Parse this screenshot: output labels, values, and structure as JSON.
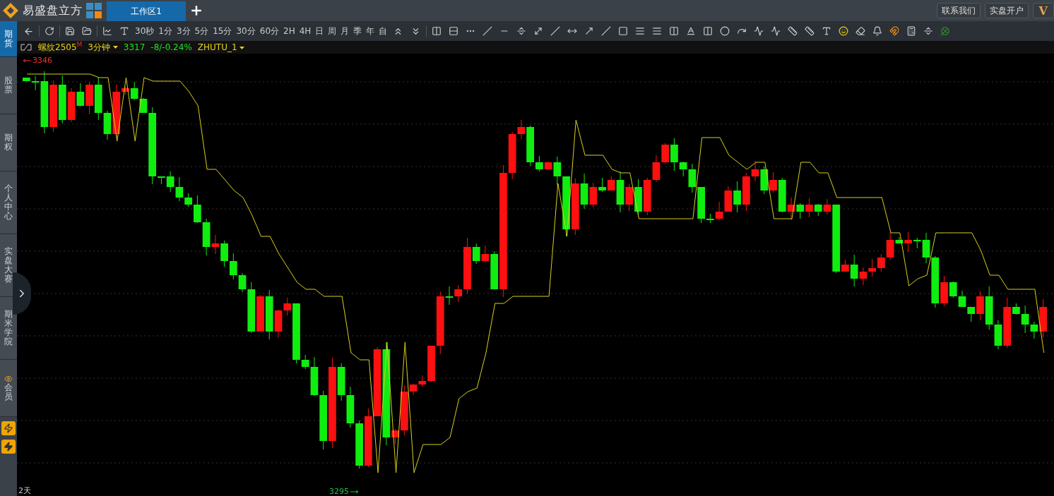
{
  "header": {
    "logo_text": "易盛盘立方",
    "tabs": [
      {
        "label": "工作区1",
        "selected": true
      }
    ],
    "right_buttons": [
      "联系我们",
      "实盘开户",
      "V"
    ]
  },
  "toolbar": {
    "periods": [
      "30秒",
      "1分",
      "3分",
      "5分",
      "15分",
      "30分",
      "60分",
      "2H",
      "4H",
      "日",
      "周",
      "月",
      "季",
      "年",
      "自"
    ]
  },
  "sidebar": {
    "items": [
      {
        "label": "期货",
        "selected": true
      },
      {
        "label": "股票",
        "selected": false
      },
      {
        "label": "期权",
        "selected": false
      },
      {
        "label": "个人中心",
        "selected": false
      },
      {
        "label": "实盘大赛",
        "selected": false
      },
      {
        "label": "期米学院",
        "selected": false
      },
      {
        "label": "会员",
        "selected": false
      }
    ]
  },
  "chart": {
    "symbol": "螺纹2505",
    "symbol_mark": "M",
    "period": "3分钟",
    "price": "3317",
    "change": "-8/-0.24%",
    "template": "ZHUTU_1",
    "high_label": "3346",
    "low_label": "3295",
    "range": "2天"
  }
}
